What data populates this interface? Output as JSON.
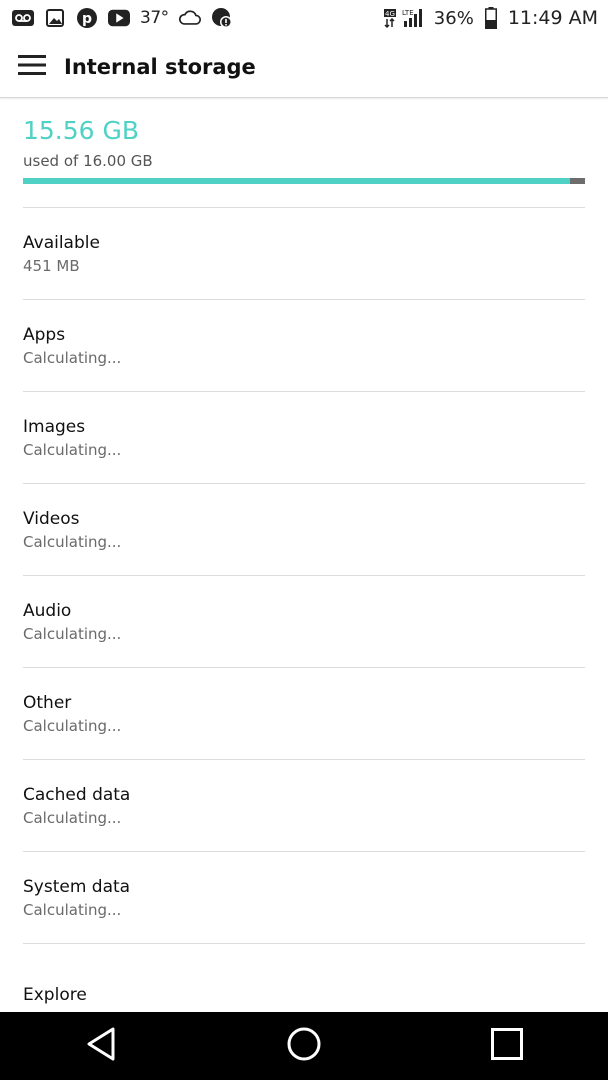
{
  "status_bar": {
    "left_icons": [
      "voicemail-icon",
      "image-icon",
      "pinterest-icon",
      "youtube-icon"
    ],
    "temperature": "37°",
    "cloud_icon": "cloud-icon",
    "notification_icon": "alert-shield-icon",
    "network_label": "4G LTE",
    "battery_percent": "36%",
    "time": "11:49 AM"
  },
  "header": {
    "title": "Internal storage",
    "menu_icon": "menu-icon"
  },
  "storage": {
    "used": "15.56 GB",
    "used_of": "used of 16.00 GB",
    "used_fraction": 0.9725,
    "accent_color": "#4fd1c5",
    "track_color": "#6d6d6d"
  },
  "items": [
    {
      "title": "Available",
      "value": "451 MB"
    },
    {
      "title": "Apps",
      "value": "Calculating..."
    },
    {
      "title": "Images",
      "value": "Calculating..."
    },
    {
      "title": "Videos",
      "value": "Calculating..."
    },
    {
      "title": "Audio",
      "value": "Calculating..."
    },
    {
      "title": "Other",
      "value": "Calculating..."
    },
    {
      "title": "Cached data",
      "value": "Calculating..."
    },
    {
      "title": "System data",
      "value": "Calculating..."
    }
  ],
  "explore": {
    "label": "Explore"
  },
  "nav": {
    "back_icon": "back-icon",
    "home_icon": "home-icon",
    "recents_icon": "recents-icon"
  }
}
